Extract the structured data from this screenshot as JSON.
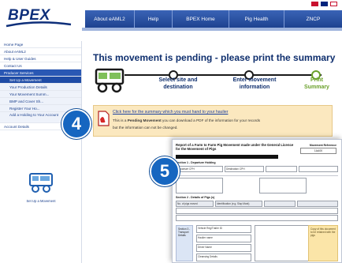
{
  "brand": {
    "logo_text": "BPEX",
    "colors": {
      "navy": "#0f2f6e",
      "nav_blue": "#2a58b4",
      "pending_green": "#6aa02a",
      "info_bg": "#fbe8bf",
      "badge_blue": "#1666c0"
    }
  },
  "nav": {
    "items": [
      {
        "label": "About eAML2"
      },
      {
        "label": "Help"
      },
      {
        "label": "BPEX Home"
      },
      {
        "label": "Pig Health"
      },
      {
        "label": "ZNCP"
      }
    ]
  },
  "sidebar": {
    "items": [
      {
        "label": "Home Page"
      },
      {
        "label": "About eAML2"
      },
      {
        "label": "Help & User Guides"
      },
      {
        "label": "Contact Us"
      },
      {
        "label": "Producer Services"
      },
      {
        "label": "Set Up a Movement"
      },
      {
        "label": "Your Production Details"
      },
      {
        "label": "Your Movement Summ..."
      },
      {
        "label": "BMP and Cover Sh..."
      },
      {
        "label": "Register Your Ho..."
      },
      {
        "label": "Add a Holding to Your Account"
      },
      {
        "label": "Account Details"
      }
    ],
    "truck_label": "Set Up a Movement"
  },
  "main": {
    "title": "This movement is pending - please print the summary",
    "steps": [
      {
        "label": "Select site and destination"
      },
      {
        "label": "Enter movement information"
      },
      {
        "label": "Print Summary"
      }
    ]
  },
  "info": {
    "link": "Click here for the summary which you must hand to your haulier",
    "line1_prefix": "This is a ",
    "line1_bold": "Pending Movement",
    "line1_suffix": " you can download a PDF of the information for your records",
    "line2": "but the information can not be changed."
  },
  "badges": {
    "four": "4",
    "five": "5"
  },
  "document": {
    "title": "Report of a Farm to Farm Pig Movement made under the General Licence for the Movement of Pigs",
    "right_label": "Movement Reference",
    "right_value": "1AA00",
    "section1": "Section 1 - Departure Holding",
    "section2": "Section 2 - Details of Pigs (s)",
    "section3": "Section 3 - Transport Details",
    "departure_label": "Departure CPH",
    "destination_label": "Destination CPH",
    "pigs_label": "No. of pigs moved",
    "identification_label": "Identification (e.g. Slap Mark)",
    "haulier_label": "Haulier name",
    "vehicle_label": "Vehicle Reg/Trailer ID",
    "driver_label": "Driver Name",
    "cleansing_label": "Cleansing Details",
    "note_text": "Copy of this document to be retained with the pigs"
  }
}
